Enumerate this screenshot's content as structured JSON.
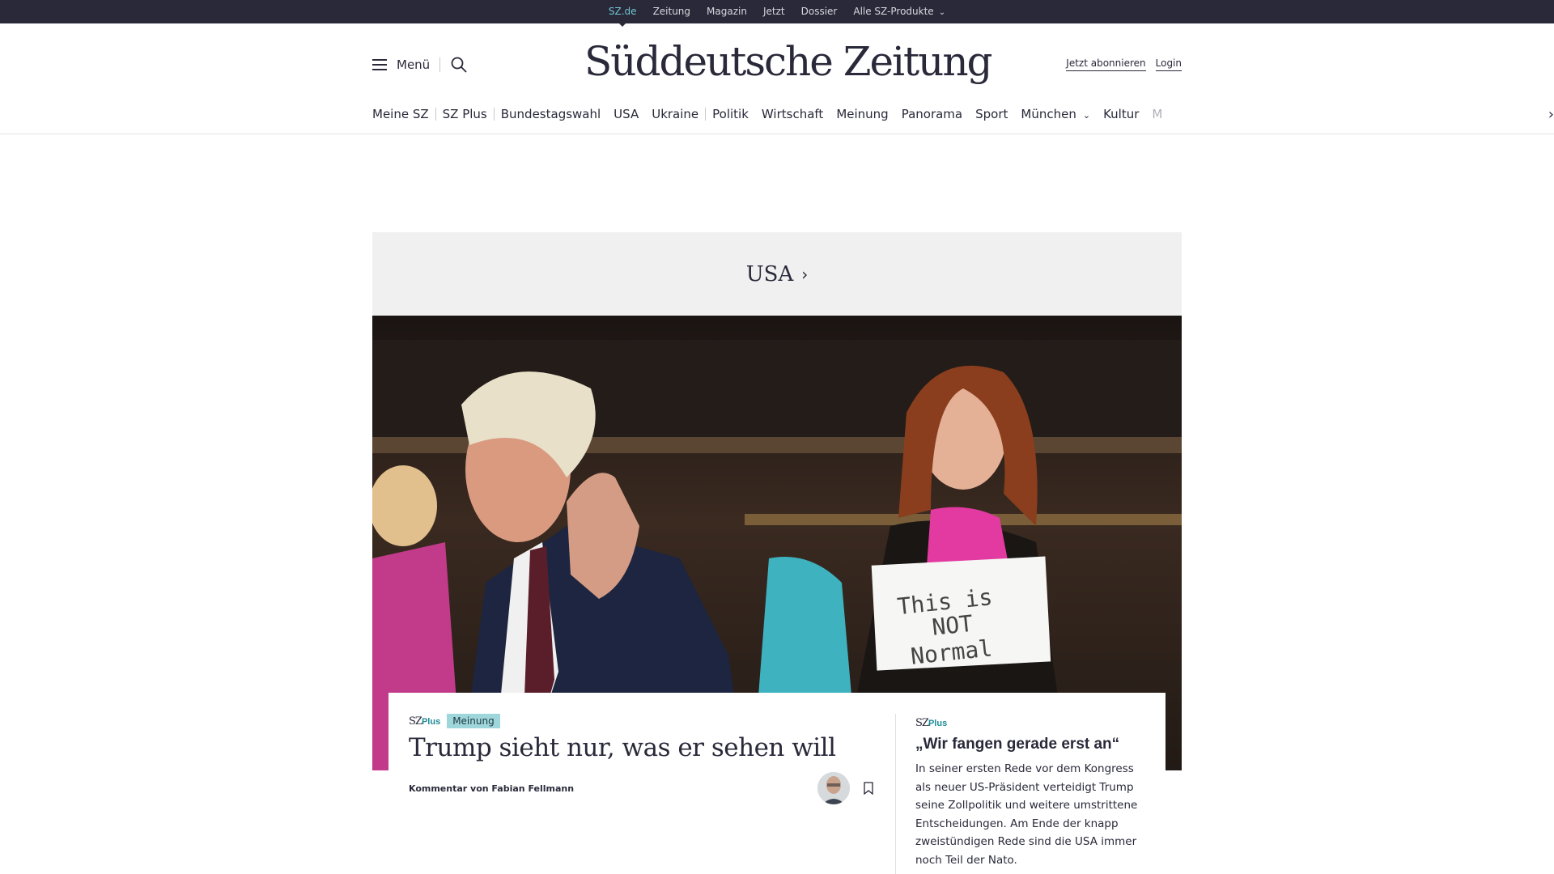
{
  "topbar": {
    "items": [
      "SZ.de",
      "Zeitung",
      "Magazin",
      "Jetzt",
      "Dossier",
      "Alle SZ-Produkte"
    ]
  },
  "header": {
    "menu_label": "Menü",
    "logo": "Süddeutsche Zeitung",
    "subscribe": "Jetzt abonnieren",
    "login": "Login"
  },
  "nav": {
    "items": [
      "Meine SZ",
      "SZ Plus",
      "Bundestagswahl",
      "USA",
      "Ukraine",
      "Politik",
      "Wirtschaft",
      "Meinung",
      "Panorama",
      "Sport",
      "München",
      "Kultur",
      "M"
    ]
  },
  "section": {
    "title": "USA"
  },
  "hero": {
    "sign_line1": "This is",
    "sign_line2": "NOT",
    "sign_line3": "Normal"
  },
  "teaser": {
    "sz": "SZ",
    "plus": "Plus",
    "tag": "Meinung",
    "headline": "Trump sieht nur, was er sehen will",
    "byline": "Kommentar von Fabian Fellmann"
  },
  "sidebar_teaser": {
    "sz": "SZ",
    "plus": "Plus",
    "title": "„Wir fangen gerade erst an“",
    "text": "In seiner ersten Rede vor dem Kongress als neuer US-Präsident verteidigt Trump seine Zollpolitik und weitere umstrittene Entscheidungen. Am Ende der knapp zweistündigen Rede sind die USA immer noch Teil der Nato."
  },
  "colors": {
    "topbar_bg": "#29293a",
    "active_link": "#71c6d2",
    "tag_bg": "#9fd6dc",
    "section_bg": "#f0f0f0"
  }
}
